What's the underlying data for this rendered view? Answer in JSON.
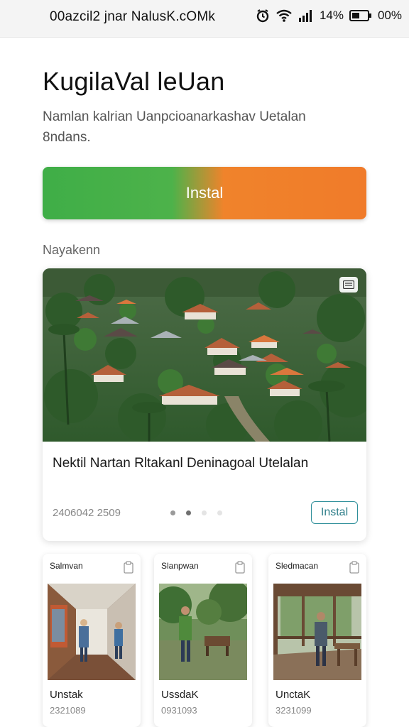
{
  "status_bar": {
    "left_text": "00azcil2 jnar NalusK.cOMk",
    "battery_text": "14%",
    "extra_text": "00%"
  },
  "header": {
    "title": "KugilaVal leUan",
    "subtitle": "Namlan kalrian Uanpcioanarkashav Uetalan 8ndans."
  },
  "main_install": {
    "label": "Instal",
    "gradient_start": "#3fae47",
    "gradient_end": "#f07b2a"
  },
  "section": {
    "label": "Nayakenn"
  },
  "feature_card": {
    "title": "Nektil Nartan Rltakanl Deninagoal Utelalan",
    "meta": "2406042 2509",
    "install_label": "Instal",
    "image": "aerial-village-photo",
    "carousel_dots": 4,
    "active_dot": 1
  },
  "mini_cards": [
    {
      "head": "Salmvan",
      "name": "Unstak",
      "num": "2321089",
      "image": "hallway-photo"
    },
    {
      "head": "Slanpwan",
      "name": "UssdaK",
      "num": "0931093",
      "image": "garden-photo"
    },
    {
      "head": "Sledmacan",
      "name": "UnctaK",
      "num": "3231099",
      "image": "veranda-photo"
    }
  ],
  "colors": {
    "accent_teal": "#2f8f9a",
    "text_dark": "#1a1a1a",
    "text_muted": "#888888"
  }
}
